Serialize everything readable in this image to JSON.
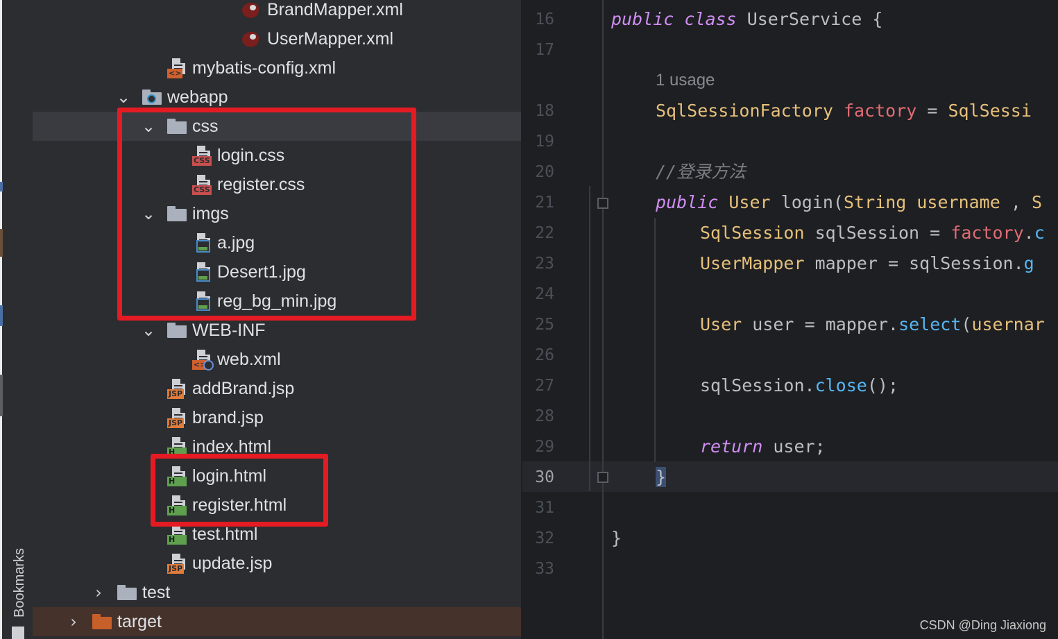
{
  "sidebar": {
    "bookmarks_label": "Bookmarks"
  },
  "tree": {
    "items": [
      {
        "label": "BrandMapper.xml",
        "icon": "mybatis-xml-icon"
      },
      {
        "label": "UserMapper.xml",
        "icon": "mybatis-xml-icon"
      },
      {
        "label": "mybatis-config.xml",
        "icon": "xml-file-icon"
      },
      {
        "label": "webapp",
        "icon": "web-folder-icon",
        "expanded": true
      },
      {
        "label": "css",
        "icon": "folder-icon",
        "expanded": true,
        "selected": true
      },
      {
        "label": "login.css",
        "icon": "css-file-icon"
      },
      {
        "label": "register.css",
        "icon": "css-file-icon"
      },
      {
        "label": "imgs",
        "icon": "folder-icon",
        "expanded": true
      },
      {
        "label": "a.jpg",
        "icon": "image-file-icon"
      },
      {
        "label": "Desert1.jpg",
        "icon": "image-file-icon"
      },
      {
        "label": "reg_bg_min.jpg",
        "icon": "image-file-icon"
      },
      {
        "label": "WEB-INF",
        "icon": "folder-icon",
        "expanded": true
      },
      {
        "label": "web.xml",
        "icon": "web-xml-icon"
      },
      {
        "label": "addBrand.jsp",
        "icon": "jsp-file-icon"
      },
      {
        "label": "brand.jsp",
        "icon": "jsp-file-icon"
      },
      {
        "label": "index.html",
        "icon": "html-file-icon"
      },
      {
        "label": "login.html",
        "icon": "html-file-icon"
      },
      {
        "label": "register.html",
        "icon": "html-file-icon"
      },
      {
        "label": "test.html",
        "icon": "html-file-icon"
      },
      {
        "label": "update.jsp",
        "icon": "jsp-file-icon"
      },
      {
        "label": "test",
        "icon": "folder-icon",
        "expanded": false
      },
      {
        "label": "target",
        "icon": "excluded-folder-icon",
        "expanded": false
      }
    ],
    "file_tags": {
      "css": "CSS",
      "jsp": "JSP",
      "html": "H",
      "xml": "<>"
    }
  },
  "editor": {
    "line_numbers": [
      "16",
      "17",
      "18",
      "19",
      "20",
      "21",
      "22",
      "23",
      "24",
      "25",
      "26",
      "27",
      "28",
      "29",
      "30",
      "31",
      "32",
      "33"
    ],
    "current_line": "30",
    "usage_hint": "1 usage",
    "tokens": {
      "public": "public",
      "class": "class",
      "class_name": "UserService",
      "open_brace": "{",
      "close_brace": "}",
      "factory_type": "SqlSessionFactory",
      "factory_field": "factory",
      "equals": "=",
      "factory_value": "SqlSessi",
      "comment": "//登录方法",
      "user_type": "User",
      "login_method": "login",
      "open_paren": "(",
      "string_type": "String",
      "username_param": "username",
      "comma": " ,",
      "next_char": "S",
      "sqlsession_type": "SqlSession",
      "sqlsession_var": "sqlSession",
      "factory_ref": "factory",
      "dot": ".",
      "dot_cut": "c",
      "usermapper_type": "UserMapper",
      "mapper_var": "mapper",
      "sqlsession_ref": "sqlSession",
      "dot_cut_g": "g",
      "user_var": "user",
      "mapper_ref": "mapper",
      "select_method": "select",
      "username_cut": "usernar",
      "close_method": "close",
      "parens_semicolon": "();",
      "return_kw": "return",
      "user_ref": "user",
      "semicolon": ";"
    }
  },
  "watermark": "CSDN @Ding Jiaxiong",
  "colors": {
    "tree_bg": "#2b2d30",
    "editor_bg": "#1e1f22",
    "highlight_box": "#e51b23",
    "keyword": "#cf8ef4",
    "type": "#e6c07b",
    "field": "#e06c75",
    "method": "#56b6f2"
  }
}
